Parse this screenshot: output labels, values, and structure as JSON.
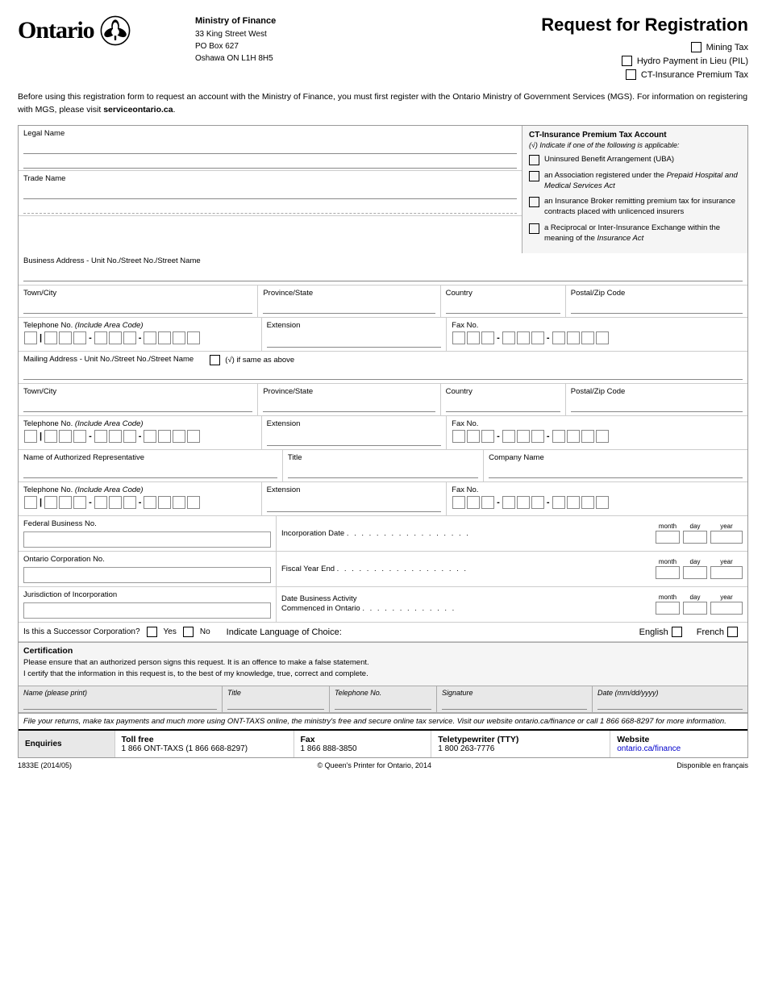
{
  "header": {
    "ontario_text": "Ontario",
    "ministry_name": "Ministry of Finance",
    "address_line1": "33 King Street West",
    "address_line2": "PO Box 627",
    "address_line3": "Oshawa ON  L1H 8H5",
    "title": "Request for Registration",
    "checkbox1": "Mining Tax",
    "checkbox2": "Hydro Payment in Lieu (PIL)",
    "checkbox3": "CT-Insurance Premium Tax"
  },
  "intro": {
    "text1": "Before using this registration form to request an account with the Ministry of Finance, you must first register with the Ontario Ministry of Government Services (MGS). For information on registering with MGS, please visit ",
    "link": "serviceontario.ca",
    "text2": "."
  },
  "ct_panel": {
    "title": "CT-Insurance Premium Tax Account",
    "subtitle": "(√) Indicate if one of the following is applicable:",
    "items": [
      "Uninsured Benefit Arrangement (UBA)",
      "an Association registered under the Prepaid Hospital and Medical Services Act",
      "an Insurance Broker remitting premium tax for insurance contracts placed with unlicenced insurers",
      "a Reciprocal or Inter-Insurance Exchange within the meaning of the Insurance Act"
    ],
    "items_italic": [
      false,
      "Prepaid Hospital and Medical Services Act",
      false,
      "Insurance Act"
    ]
  },
  "fields": {
    "legal_name_label": "Legal Name",
    "trade_name_label": "Trade Name",
    "business_address_label": "Business Address - Unit No./Street No./Street Name",
    "town_city_label": "Town/City",
    "province_state_label": "Province/State",
    "country_label": "Country",
    "postal_zip_label": "Postal/Zip Code",
    "telephone_label": "Telephone No.",
    "telephone_note": "(Include Area Code)",
    "extension_label": "Extension",
    "fax_label": "Fax No.",
    "mailing_address_label": "Mailing Address - Unit No./Street No./Street Name",
    "same_as_above_label": "(√) if same as above",
    "auth_rep_label": "Name of Authorized Representative",
    "title_label": "Title",
    "company_name_label": "Company Name",
    "federal_business_label": "Federal Business No.",
    "incorporation_date_label": "Incorporation Date",
    "incorporation_dots": ". . . . . . . . . . . . . . . . .",
    "ontario_corp_label": "Ontario Corporation No.",
    "fiscal_year_label": "Fiscal Year End",
    "fiscal_dots": ". . . . . . . . . . . . . . . . . .",
    "jurisdiction_label": "Jurisdiction of Incorporation",
    "date_business_label": "Date Business Activity",
    "commenced_label": "Commenced in Ontario",
    "commenced_dots": ". . . . . . . . . . . . .",
    "month_label": "month",
    "day_label": "day",
    "year_label": "year",
    "successor_label": "Is this a Successor Corporation?",
    "yes_label": "Yes",
    "no_label": "No",
    "indicate_language": "Indicate Language of Choice:",
    "english_label": "English",
    "french_label": "French"
  },
  "certification": {
    "title": "Certification",
    "text1": "Please ensure that an authorized person signs this request.  It is an offence to make a false statement.",
    "text2": "I certify that the information in this request is, to the best of my knowledge, true, correct and complete.",
    "name_label": "Name (please print)",
    "title_field_label": "Title",
    "telephone_label": "Telephone No.",
    "signature_label": "Signature",
    "date_label": "Date (mm/dd/yyyy)"
  },
  "file_returns": {
    "text": "File your returns, make tax payments and much more using ONT-TAXS online, the ministry's free and secure online tax service.  Visit our website ontario.ca/finance or call 1 866 668-8297 for more information."
  },
  "enquiries": {
    "label": "Enquiries",
    "toll_free_header": "Toll free",
    "toll_free_number": "1 866 ONT-TAXS (1 866 668-8297)",
    "fax_header": "Fax",
    "fax_number": "1 866 888-3850",
    "tty_header": "Teletypewriter (TTY)",
    "tty_number": "1 800 263-7776",
    "website_header": "Website",
    "website_link": "ontario.ca/finance"
  },
  "footer": {
    "form_number": "1833E (2014/05)",
    "copyright": "© Queen's Printer for Ontario, 2014",
    "french_text": "Disponible en français"
  }
}
